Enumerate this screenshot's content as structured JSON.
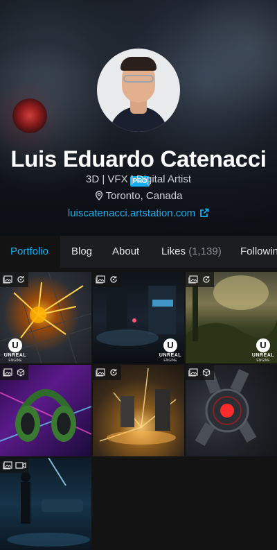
{
  "profile": {
    "name": "Luis Eduardo Catenacci",
    "pro_badge": "PRO",
    "tagline": "3D | VFX | Digital Artist",
    "location": "Toronto, Canada",
    "website": "luiscatenacci.artstation.com"
  },
  "tabs": [
    {
      "label": "Portfolio",
      "active": true
    },
    {
      "label": "Blog"
    },
    {
      "label": "About"
    },
    {
      "label": "Likes",
      "count": "(1,139)"
    },
    {
      "label": "Following"
    }
  ],
  "ue_logo": {
    "line1": "UNREAL",
    "line2": "ENGINE"
  },
  "thumbnails": [
    {
      "title": "fireworks-explosion",
      "badges": [
        "image-icon",
        "rotate-icon"
      ],
      "ue_logo": true
    },
    {
      "title": "neon-street",
      "badges": [
        "image-icon",
        "rotate-icon"
      ],
      "ue_logo": true
    },
    {
      "title": "forest-landscape",
      "badges": [
        "image-icon",
        "rotate-icon"
      ],
      "ue_logo": true
    },
    {
      "title": "headset",
      "badges": [
        "image-icon",
        "cube-icon"
      ],
      "ue_logo": false
    },
    {
      "title": "golden-sparks",
      "badges": [
        "image-icon",
        "rotate-icon"
      ],
      "ue_logo": false
    },
    {
      "title": "red-robot-core",
      "badges": [
        "image-icon",
        "cube-icon"
      ],
      "ue_logo": false
    },
    {
      "title": "figure-in-blue-light",
      "badges": [
        "image-icon",
        "video-icon"
      ],
      "ue_logo": false
    }
  ],
  "colors": {
    "accent": "#13aff0",
    "background": "#131313",
    "tabbar": "#1c1d20"
  }
}
